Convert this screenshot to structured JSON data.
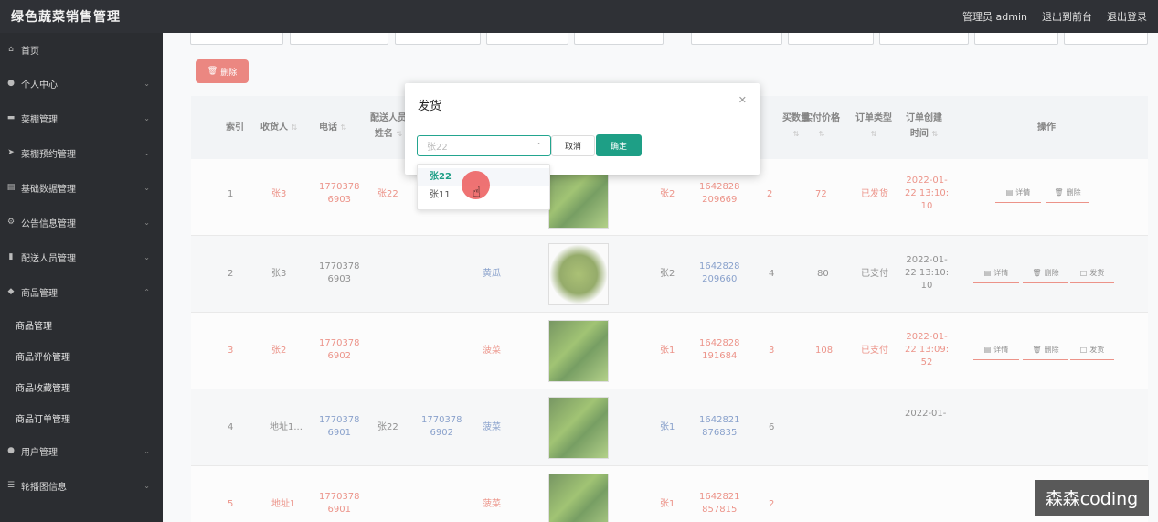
{
  "app": {
    "title": "绿色蔬菜销售管理"
  },
  "top_links": [
    "管理员 admin",
    "退出到前台",
    "退出登录"
  ],
  "sidebar": {
    "items": [
      {
        "label": "首页",
        "icon": "home-icon"
      },
      {
        "label": "个人中心",
        "icon": "user-icon"
      },
      {
        "label": "菜棚管理",
        "icon": "greenhouse-icon"
      },
      {
        "label": "菜棚预约管理",
        "icon": "send-icon"
      },
      {
        "label": "基础数据管理",
        "icon": "database-icon"
      },
      {
        "label": "公告信息管理",
        "icon": "gear-icon"
      },
      {
        "label": "配送人员管理",
        "icon": "bar-chart-icon"
      },
      {
        "label": "商品管理",
        "icon": "pin-icon"
      }
    ],
    "sub_items": [
      "商品管理",
      "商品评价管理",
      "商品收藏管理",
      "商品订单管理"
    ],
    "bottom_items": [
      {
        "label": "用户管理",
        "icon": "users-icon"
      },
      {
        "label": "轮播图信息",
        "icon": "sliders-icon"
      }
    ]
  },
  "toolbar": {
    "delete_label": "删除"
  },
  "table": {
    "headers": {
      "index": "索引",
      "receiver": "收货人",
      "phone": "电话",
      "courier_name_1": "配送人员",
      "courier_name_2": "姓名",
      "buy_count": "买数量",
      "paid_price": "实付价格",
      "order_type": "订单类型",
      "created_1": "订单创建",
      "created_2": "时间",
      "actions": "操作"
    },
    "rows": [
      {
        "index": "1",
        "receiver": "张3",
        "phone_1": "1770378",
        "phone_2": "6903",
        "courier": "张22",
        "courier_phone_1": "",
        "courier_phone_2": "",
        "product": "",
        "user": "张2",
        "order_1": "1642828",
        "order_2": "209669",
        "qty": "2",
        "price": "72",
        "type": "已发货",
        "time_1": "2022-01-",
        "time_2": "22 13:10:",
        "time_3": "10",
        "buttons": [
          "详情",
          "删除"
        ]
      },
      {
        "index": "2",
        "receiver": "张3",
        "phone_1": "1770378",
        "phone_2": "6903",
        "courier": "",
        "courier_phone_1": "",
        "courier_phone_2": "",
        "product": "黄瓜",
        "user": "张2",
        "order_1": "1642828",
        "order_2": "209660",
        "qty": "4",
        "price": "80",
        "type": "已支付",
        "time_1": "2022-01-",
        "time_2": "22 13:10:",
        "time_3": "10",
        "buttons": [
          "详情",
          "删除",
          "发货"
        ]
      },
      {
        "index": "3",
        "receiver": "张2",
        "phone_1": "1770378",
        "phone_2": "6902",
        "courier": "",
        "courier_phone_1": "",
        "courier_phone_2": "",
        "product": "菠菜",
        "user": "张1",
        "order_1": "1642828",
        "order_2": "191684",
        "qty": "3",
        "price": "108",
        "type": "已支付",
        "time_1": "2022-01-",
        "time_2": "22 13:09:",
        "time_3": "52",
        "buttons": [
          "详情",
          "删除",
          "发货"
        ]
      },
      {
        "index": "4",
        "receiver": "地址1...",
        "phone_1": "1770378",
        "phone_2": "6901",
        "courier": "张22",
        "courier_phone_1": "1770378",
        "courier_phone_2": "6902",
        "product": "菠菜",
        "user": "张1",
        "order_1": "1642821",
        "order_2": "876835",
        "qty": "6",
        "price": "",
        "type": "",
        "time_1": "2022-01-",
        "time_2": "",
        "time_3": "",
        "buttons": []
      },
      {
        "index": "5",
        "receiver": "地址1",
        "phone_1": "1770378",
        "phone_2": "6901",
        "courier": "",
        "courier_phone_1": "",
        "courier_phone_2": "",
        "product": "菠菜",
        "user": "张1",
        "order_1": "1642821",
        "order_2": "857815",
        "qty": "2",
        "price": "",
        "type": "",
        "time_1": "",
        "time_2": "",
        "time_3": "",
        "buttons": []
      }
    ]
  },
  "dialog": {
    "title": "发货",
    "select_placeholder": "张22",
    "cancel_label": "取消",
    "ok_label": "确定",
    "options": [
      "张22",
      "张11"
    ],
    "selected_option": "张22"
  },
  "watermark": "森森coding",
  "colors": {
    "accent": "#1e9f86",
    "danger": "#e0483e",
    "topbar": "#2f3136",
    "sidebar": "#2b2d31"
  }
}
